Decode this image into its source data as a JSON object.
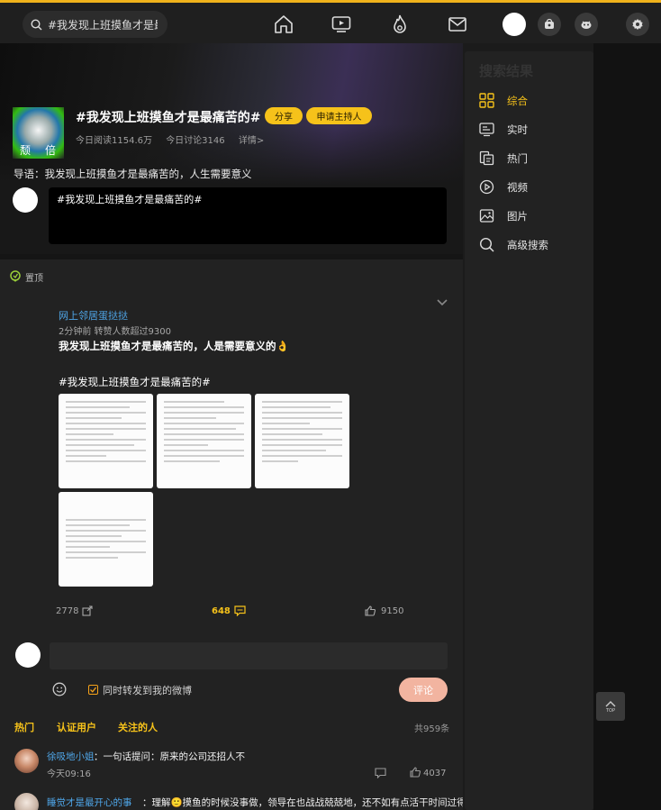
{
  "header": {
    "search_value": "#我发现上班摸鱼才是最痛苦的#",
    "nav_icons": [
      "home-icon",
      "video-icon",
      "hot-icon",
      "message-icon"
    ],
    "right_icons": [
      "profile-avatar",
      "post-icon",
      "game-icon",
      "settings-icon"
    ]
  },
  "topic": {
    "title": "#我发现上班摸鱼才是最痛苦的#",
    "thumb_text_left": "颓",
    "thumb_text_right": "倍",
    "share_label": "分享",
    "host_label": "申请主持人",
    "read_count": "今日阅读1154.6万",
    "discuss_count": "今日讨论3146",
    "details_label": "详情>",
    "guide": "导语：我发现上班摸鱼才是最痛苦的，人生需要意义",
    "host_post_text": "#我发现上班摸鱼才是最痛苦的#"
  },
  "post": {
    "pin_label": "置顶",
    "author": "网上邻居蛋挞挞",
    "meta": "2分钟前 转赞人数超过9300",
    "text": "我发现上班摸鱼才是最痛苦的，人是需要意义的👌",
    "hashtag": "#我发现上班摸鱼才是最痛苦的#",
    "repost_count": "2778",
    "comment_count": "648",
    "like_count": "9150"
  },
  "comment_box": {
    "placeholder": "",
    "repost_label": "同时转发到我的微博",
    "submit_label": "评论"
  },
  "comment_tabs": {
    "hot": "热门",
    "verified": "认证用户",
    "following": "关注的人",
    "total": "共959条"
  },
  "comments": [
    {
      "user": "徐吸地小姐",
      "text": "：一句话提问：原来的公司还招人不",
      "time": "今天09:16",
      "likes": "4037"
    },
    {
      "user": "睡觉才是最开心的事",
      "text": "：理解🙂摸鱼的时候没事做，领导在也战战兢兢地，还不如有点活干时间过得特"
    }
  ],
  "sidebar": {
    "title": "搜索结果",
    "items": [
      {
        "label": "综合",
        "icon": "grid-icon",
        "active": true
      },
      {
        "label": "实时",
        "icon": "realtime-icon"
      },
      {
        "label": "热门",
        "icon": "hot-list-icon"
      },
      {
        "label": "视频",
        "icon": "video-play-icon"
      },
      {
        "label": "图片",
        "icon": "image-icon"
      },
      {
        "label": "高级搜索",
        "icon": "advanced-search-icon"
      }
    ]
  },
  "back_to_top": "TOP",
  "colors": {
    "accent": "#f6c21a",
    "link": "#4fa6e8",
    "background": "#1b1b1b"
  }
}
